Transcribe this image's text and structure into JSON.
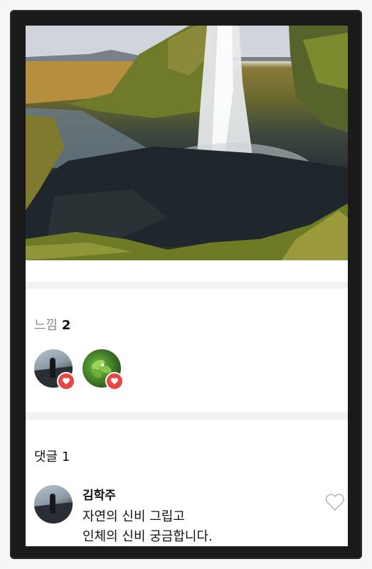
{
  "feelings": {
    "label": "느낌",
    "count": "2"
  },
  "comments": {
    "label": "댓글",
    "count": "1",
    "items": [
      {
        "author": "김학주",
        "lines": [
          "자연의 신비 그립고",
          "인체의 신비 궁금합니다."
        ]
      }
    ]
  },
  "colors": {
    "heart_badge": "#e94545",
    "divider": "#f1f1f1"
  }
}
